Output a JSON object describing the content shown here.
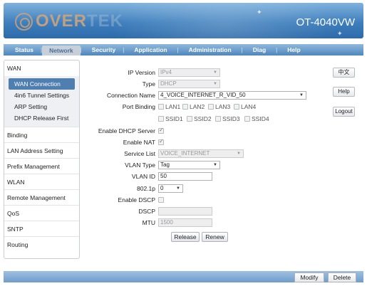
{
  "banner": {
    "logo_text": "OVERTEK",
    "model": "OT-4040VW"
  },
  "nav": {
    "items": [
      {
        "label": "Status",
        "active": false
      },
      {
        "label": "Network",
        "active": true
      },
      {
        "label": "Security",
        "active": false
      },
      {
        "label": "Application",
        "active": false
      },
      {
        "label": "Administration",
        "active": false
      },
      {
        "label": "Diag",
        "active": false
      },
      {
        "label": "Help",
        "active": false
      }
    ]
  },
  "sidebar": {
    "wan_group": "WAN",
    "wan_subitems": [
      "WAN Connection",
      "4in6 Tunnel Settings",
      "ARP Setting",
      "DHCP Release First"
    ],
    "groups": [
      "Binding",
      "LAN Address Setting",
      "Prefix Management",
      "WLAN",
      "Remote Management",
      "QoS",
      "SNTP",
      "Routing"
    ]
  },
  "right_buttons": {
    "lang": "中文",
    "help": "Help",
    "logout": "Logout"
  },
  "form": {
    "ip_version": {
      "label": "IP Version",
      "value": "IPv4"
    },
    "type": {
      "label": "Type",
      "value": "DHCP"
    },
    "connection_name": {
      "label": "Connection Name",
      "value": "4_VOICE_INTERNET_R_VID_50"
    },
    "port_binding": {
      "label": "Port Binding",
      "lan": [
        "LAN1",
        "LAN2",
        "LAN3",
        "LAN4"
      ],
      "ssid": [
        "SSID1",
        "SSID2",
        "SSID3",
        "SSID4"
      ]
    },
    "enable_dhcp_server": {
      "label": "Enable DHCP Server",
      "checked": true
    },
    "enable_nat": {
      "label": "Enable NAT",
      "checked": true
    },
    "service_list": {
      "label": "Service List",
      "value": "VOICE_INTERNET"
    },
    "vlan_type": {
      "label": "VLAN Type",
      "value": "Tag"
    },
    "vlan_id": {
      "label": "VLAN ID",
      "value": "50"
    },
    "dot1p": {
      "label": "802.1p",
      "value": "0"
    },
    "enable_dscp": {
      "label": "Enable DSCP",
      "checked": false
    },
    "dscp": {
      "label": "DSCP",
      "value": ""
    },
    "mtu": {
      "label": "MTU",
      "value": "1500"
    },
    "release_label": "Release",
    "renew_label": "Renew"
  },
  "bottom": {
    "modify_label": "Modify",
    "delete_label": "Delete"
  },
  "colors": {
    "banner_blue": "#3f7fbd",
    "nav_blue": "#4f86bd",
    "sidebar_active": "#4f7fb0"
  }
}
